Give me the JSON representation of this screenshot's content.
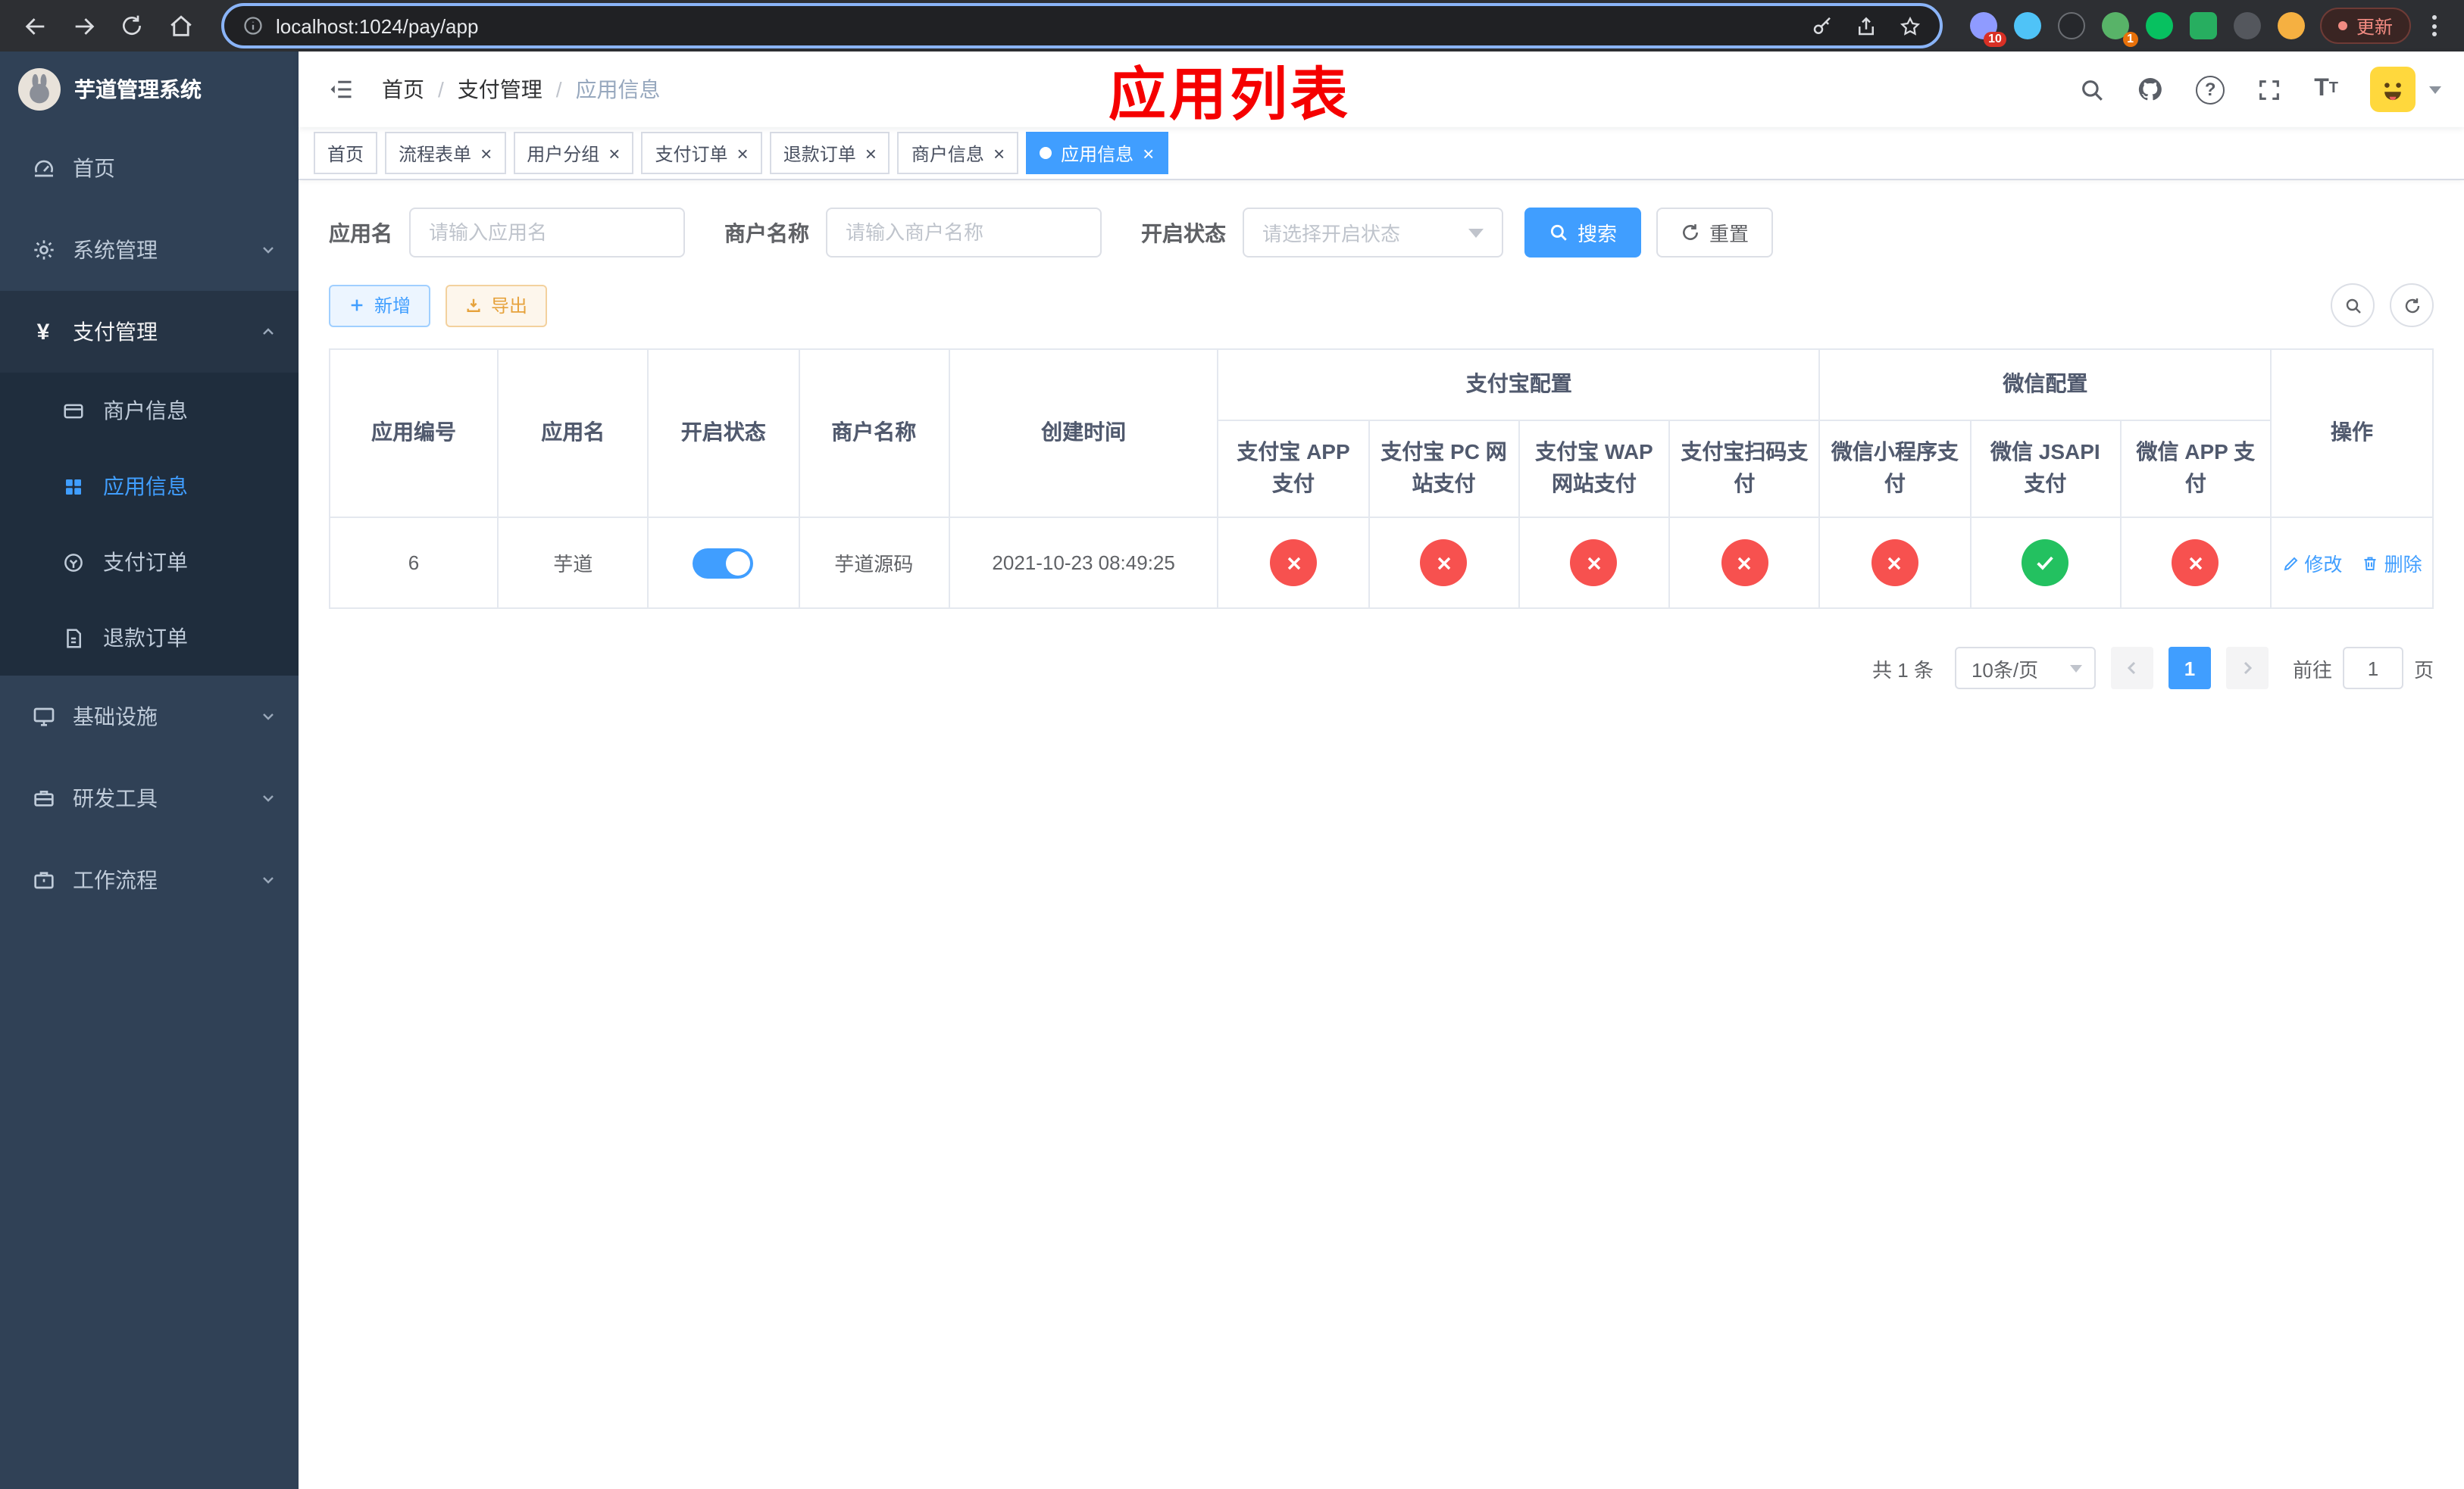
{
  "browser": {
    "url": "localhost:1024/pay/app",
    "update_label": "更新",
    "ext_badge_a": "10",
    "ext_badge_b": "1"
  },
  "sidebar": {
    "logo_title": "芋道管理系统",
    "home": "首页",
    "system": "系统管理",
    "pay": "支付管理",
    "pay_children": {
      "merchant": "商户信息",
      "app": "应用信息",
      "order": "支付订单",
      "refund": "退款订单"
    },
    "infra": "基础设施",
    "devtools": "研发工具",
    "workflow": "工作流程"
  },
  "navbar": {
    "breadcrumb": [
      "首页",
      "支付管理",
      "应用信息"
    ],
    "separator": "/",
    "annotation": "应用列表"
  },
  "tabs": [
    {
      "label": "首页",
      "closable": false,
      "active": false
    },
    {
      "label": "流程表单",
      "closable": true,
      "active": false
    },
    {
      "label": "用户分组",
      "closable": true,
      "active": false
    },
    {
      "label": "支付订单",
      "closable": true,
      "active": false
    },
    {
      "label": "退款订单",
      "closable": true,
      "active": false
    },
    {
      "label": "商户信息",
      "closable": true,
      "active": false
    },
    {
      "label": "应用信息",
      "closable": true,
      "active": true
    }
  ],
  "filters": {
    "app_name_label": "应用名",
    "app_name_placeholder": "请输入应用名",
    "merchant_label": "商户名称",
    "merchant_placeholder": "请输入商户名称",
    "status_label": "开启状态",
    "status_placeholder": "请选择开启状态",
    "search_label": "搜索",
    "reset_label": "重置"
  },
  "toolbar": {
    "add_label": "新增",
    "export_label": "导出"
  },
  "table": {
    "group_alipay": "支付宝配置",
    "group_wechat": "微信配置",
    "columns": [
      "应用编号",
      "应用名",
      "开启状态",
      "商户名称",
      "创建时间",
      "支付宝 APP 支付",
      "支付宝 PC 网站支付",
      "支付宝 WAP 网站支付",
      "支付宝扫码支付",
      "微信小程序支付",
      "微信 JSAPI 支付",
      "微信 APP 支付",
      "操作"
    ],
    "row": {
      "id": "6",
      "name": "芋道",
      "enabled": true,
      "merchant": "芋道源码",
      "created": "2021-10-23 08:49:25",
      "statuses": [
        "no",
        "no",
        "no",
        "no",
        "no",
        "yes",
        "no"
      ],
      "edit_label": "修改",
      "delete_label": "删除"
    }
  },
  "pagination": {
    "total": "共 1 条",
    "page_size": "10条/页",
    "page": "1",
    "goto_label": "前往",
    "goto_value": "1",
    "goto_unit": "页"
  },
  "icons": {
    "close": "×",
    "question": "?"
  },
  "colors": {
    "accent": "#409eff",
    "sidebar_bg": "#304156",
    "sidebar_sub_bg": "#1f2d3d",
    "danger_circle": "#f7514f",
    "success_circle": "#23c160",
    "annotation_red": "#f50000",
    "export_orange": "#e6a23c"
  }
}
